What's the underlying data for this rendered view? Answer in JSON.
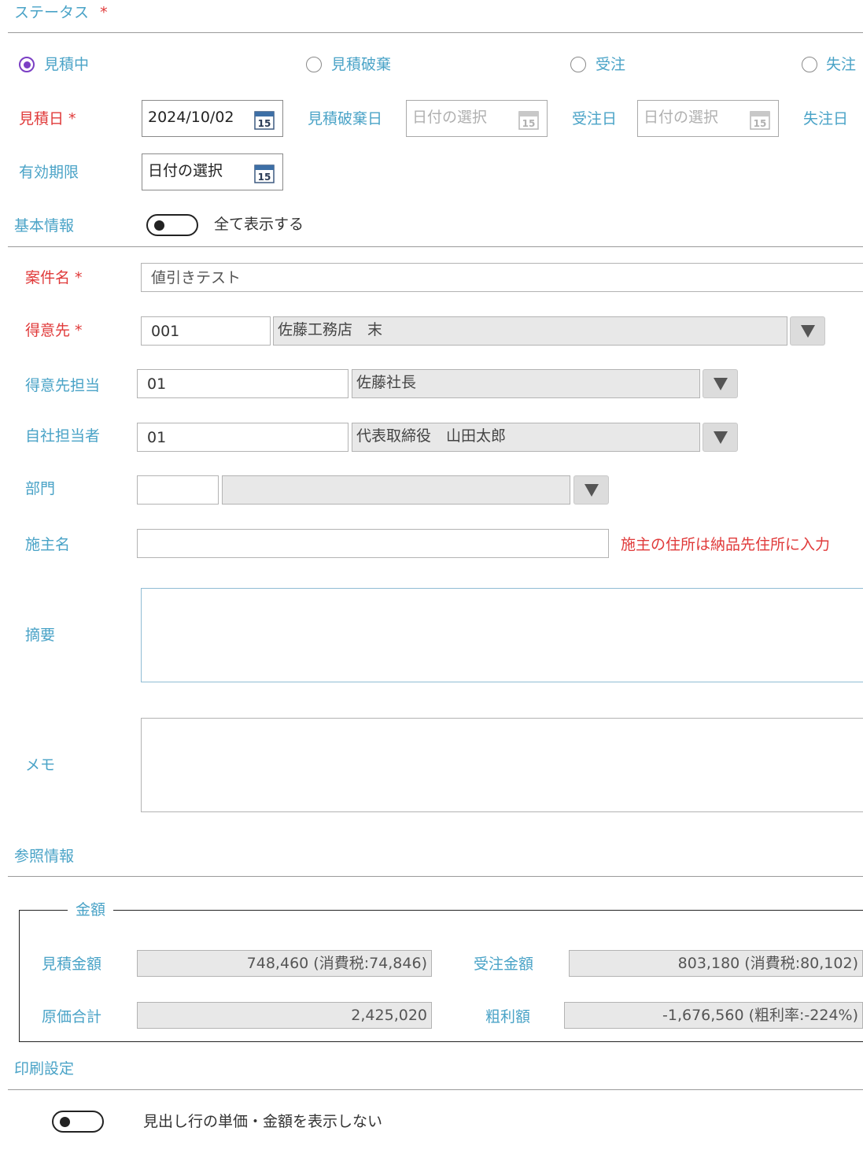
{
  "status": {
    "title": "ステータス",
    "required_mark": "*",
    "options": [
      {
        "label": "見積中",
        "checked": true
      },
      {
        "label": "見積破棄",
        "checked": false
      },
      {
        "label": "受注",
        "checked": false
      },
      {
        "label": "失注",
        "checked": false
      }
    ]
  },
  "dates": {
    "estimate_date_label": "見積日",
    "required_mark": "*",
    "estimate_date_value": "2024/10/02",
    "discard_date_label": "見積破棄日",
    "discard_date_placeholder": "日付の選択",
    "order_date_label": "受注日",
    "order_date_placeholder": "日付の選択",
    "lost_date_label": "失注日",
    "validity_label": "有効期限",
    "validity_placeholder": "日付の選択",
    "calendar_day": "15"
  },
  "basic": {
    "title": "基本情報",
    "show_all_label": "全て表示する",
    "show_all_on": false,
    "project_label": "案件名",
    "required_mark": "*",
    "project_value": "値引きテスト",
    "customer_label": "得意先",
    "customer_code": "001",
    "customer_name": "佐藤工務店　末",
    "customer_contact_label": "得意先担当",
    "customer_contact_code": "01",
    "customer_contact_name": "佐藤社長",
    "staff_label": "自社担当者",
    "staff_code": "01",
    "staff_name": "代表取締役　山田太郎",
    "department_label": "部門",
    "department_code": "",
    "department_name": "",
    "owner_label": "施主名",
    "owner_value": "",
    "owner_note": "施主の住所は納品先住所に入力",
    "summary_label": "摘要",
    "summary_value": "",
    "memo_label": "メモ",
    "memo_value": ""
  },
  "reference": {
    "title": "参照情報",
    "amount_legend": "金額",
    "estimate_amount_label": "見積金額",
    "estimate_amount_value": "748,460 (消費税:74,846)",
    "order_amount_label": "受注金額",
    "order_amount_value": "803,180 (消費税:80,102)",
    "cost_total_label": "原価合計",
    "cost_total_value": "2,425,020",
    "gross_profit_label": "粗利額",
    "gross_profit_value": "-1,676,560 (粗利率:-224%)"
  },
  "print": {
    "title": "印刷設定",
    "hide_header_prices_label": "見出し行の単価・金額を表示しない",
    "hide_header_prices_on": false
  },
  "colors": {
    "label": "#4aa3c7",
    "required": "#e03a3a",
    "radio_checked": "#7b3fc4"
  }
}
